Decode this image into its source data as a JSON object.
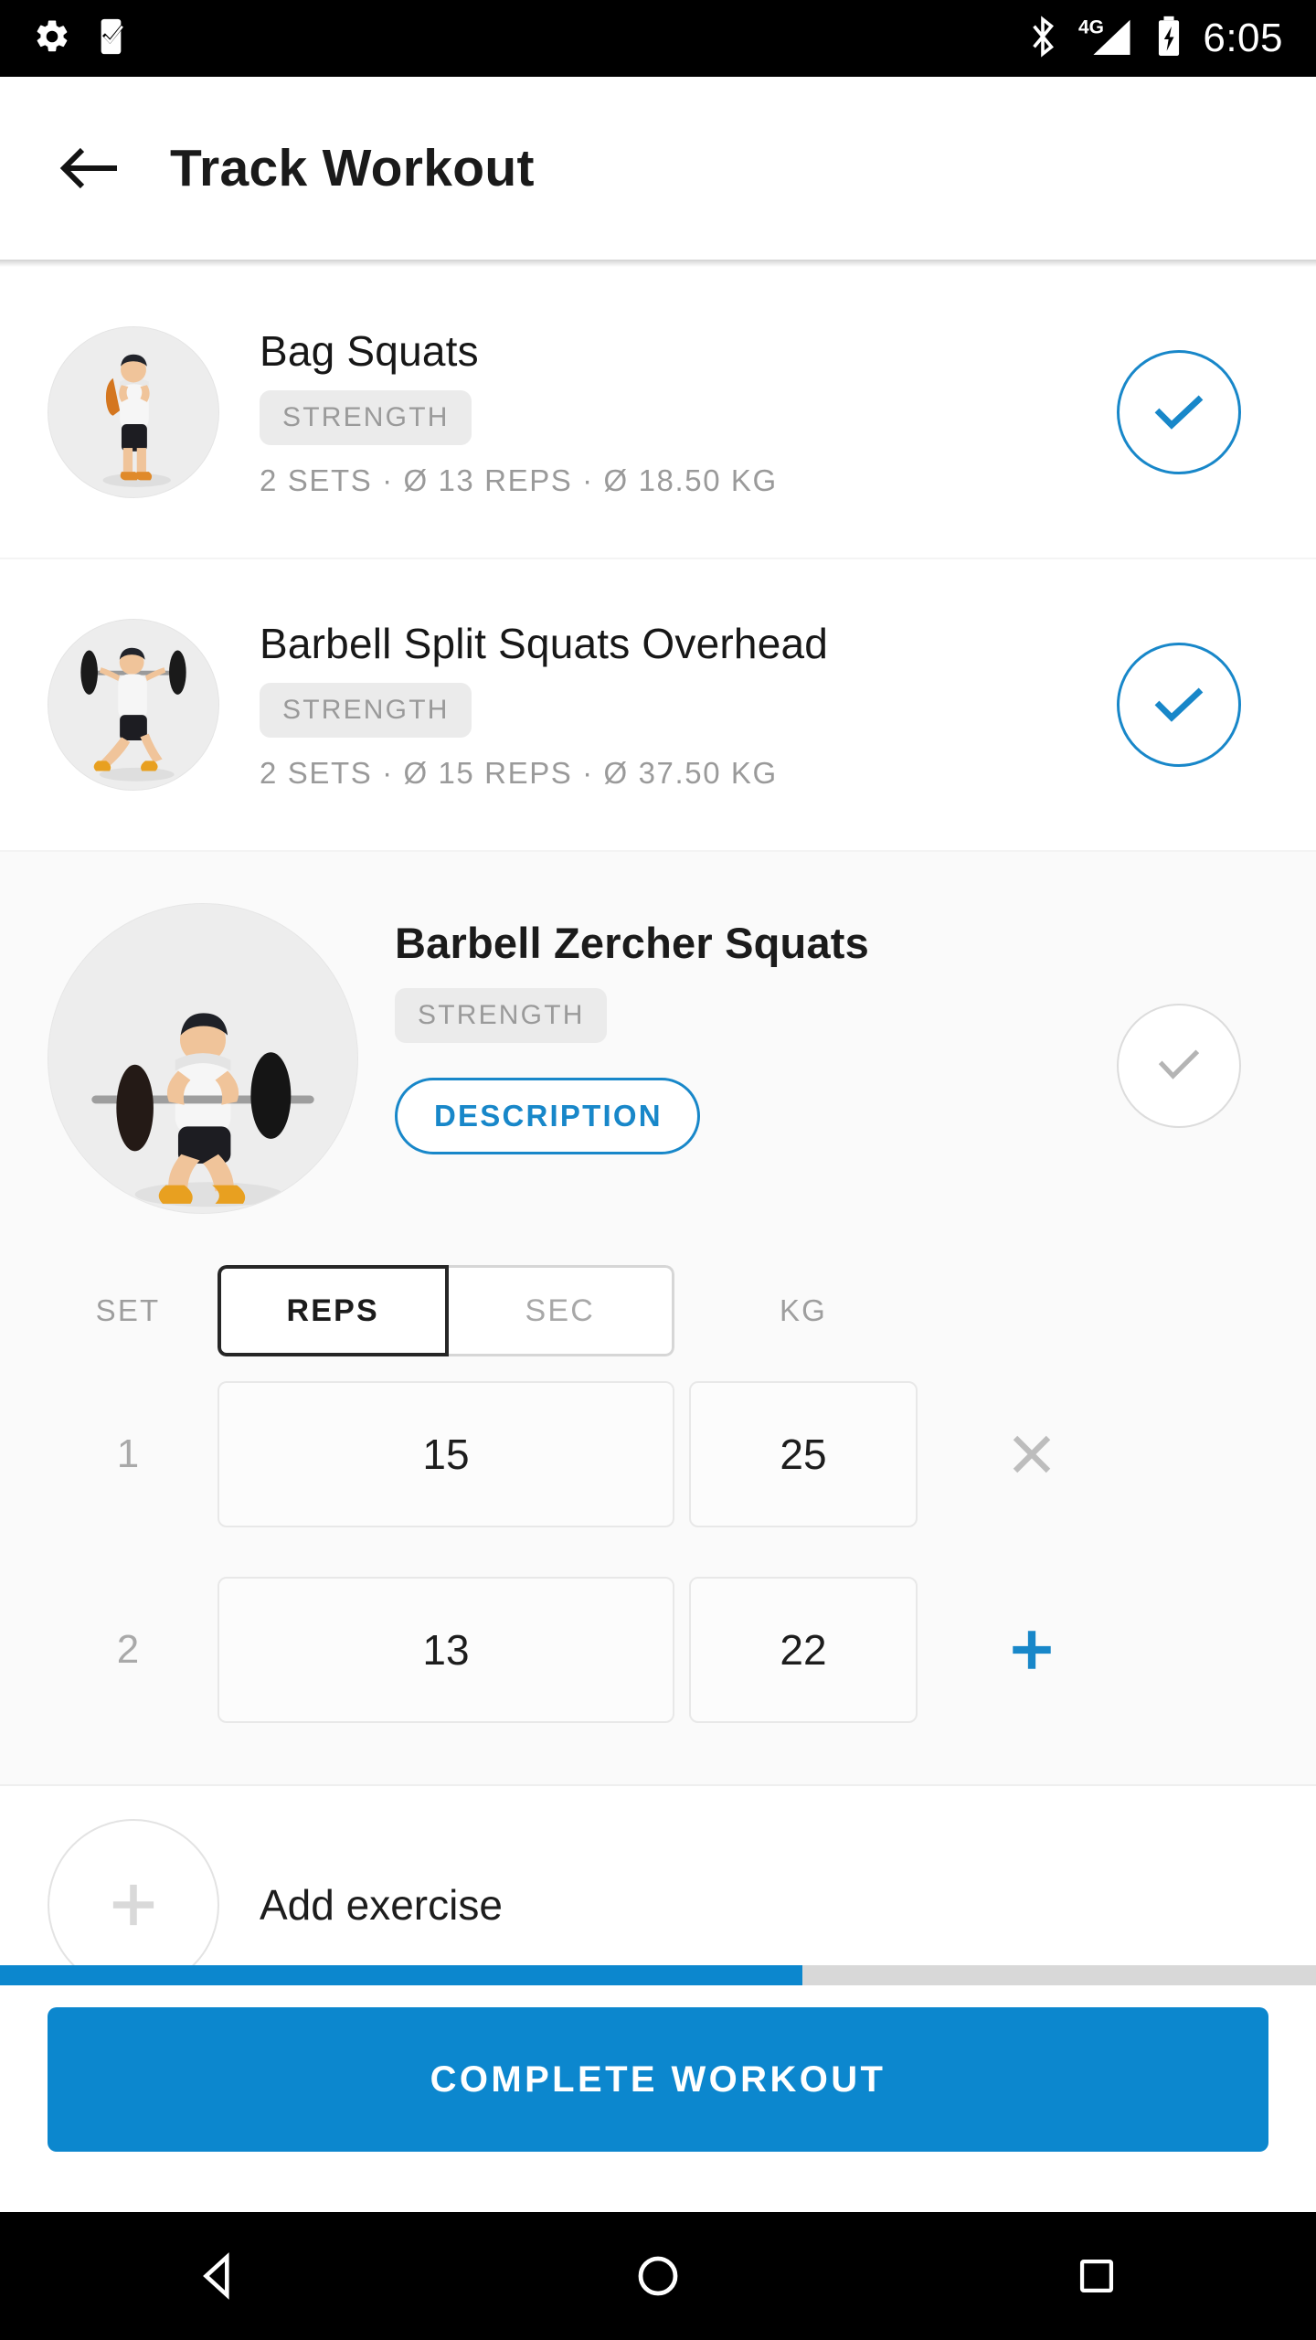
{
  "statusbar": {
    "time": "6:05",
    "icons": [
      "gear-icon",
      "phone-check-icon",
      "bluetooth-icon",
      "signal-4g-icon",
      "battery-charging-icon"
    ],
    "network_label": "4G"
  },
  "appbar": {
    "back_icon": "arrow-left-icon",
    "title": "Track Workout"
  },
  "exercises": [
    {
      "name": "Bag Squats",
      "category": "STRENGTH",
      "summary": "2 SETS · Ø 13 REPS  · Ø 18.50 KG",
      "sets": 2,
      "avg_reps": 13,
      "avg_kg": "18.50",
      "completed": true,
      "expanded": false
    },
    {
      "name": "Barbell Split Squats Overhead",
      "category": "STRENGTH",
      "summary": "2 SETS · Ø 15 REPS  · Ø 37.50 KG",
      "sets": 2,
      "avg_reps": 15,
      "avg_kg": "37.50",
      "completed": true,
      "expanded": false
    }
  ],
  "expanded_exercise": {
    "name": "Barbell Zercher Squats",
    "category": "STRENGTH",
    "description_label": "DESCRIPTION",
    "completed": false,
    "columns": {
      "set": "SET",
      "reps": "REPS",
      "sec": "SEC",
      "kg": "KG",
      "unit_selected": "REPS"
    },
    "rows": [
      {
        "set": "1",
        "reps": "15",
        "kg": "25",
        "action": "remove"
      },
      {
        "set": "2",
        "reps": "13",
        "kg": "22",
        "action": "add"
      }
    ]
  },
  "add_exercise": {
    "label": "Add exercise",
    "icon": "plus-icon"
  },
  "progress": {
    "percent": 61
  },
  "cta": {
    "label": "COMPLETE WORKOUT"
  },
  "navbar": {
    "back": "nav-back-icon",
    "home": "nav-home-icon",
    "recents": "nav-recents-icon"
  },
  "colors": {
    "accent": "#0c87ce",
    "accent_outline": "#1887c9",
    "muted_text": "#9a9a9a",
    "card_bg": "#fafafa",
    "progress_track": "#d8d8d8"
  }
}
